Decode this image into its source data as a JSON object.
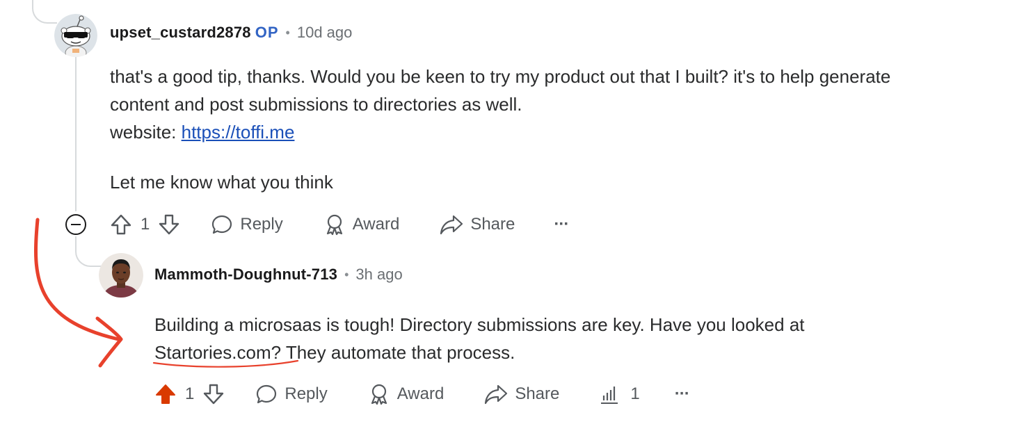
{
  "comment1": {
    "username": "upset_custard2878",
    "op_badge": "OP",
    "separator": "•",
    "time": "10d ago",
    "line1": "that's a good tip, thanks. Would you be keen to try my product out that I built? it's to help generate",
    "line2": "content and post submissions to directories as well.",
    "website_prefix": "website: ",
    "website_link": "https://toffi.me",
    "line4": "Let me know what you think",
    "vote_count": "1",
    "reply_label": "Reply",
    "award_label": "Award",
    "share_label": "Share",
    "more_label": "···"
  },
  "comment2": {
    "username": "Mammoth-Doughnut-713",
    "separator": "•",
    "time": "3h ago",
    "line1": "Building a microsaas is tough! Directory submissions are key. Have you looked at",
    "line2_link": "Startories.com?",
    "line2_rest": " They automate that process.",
    "vote_count": "1",
    "reply_label": "Reply",
    "award_label": "Award",
    "share_label": "Share",
    "insights_count": "1",
    "more_label": "···"
  },
  "colors": {
    "upvoted": "#d93a00",
    "annotation": "#e8412c",
    "op_blue": "#3264c4",
    "link_blue": "#1a4fb8"
  }
}
